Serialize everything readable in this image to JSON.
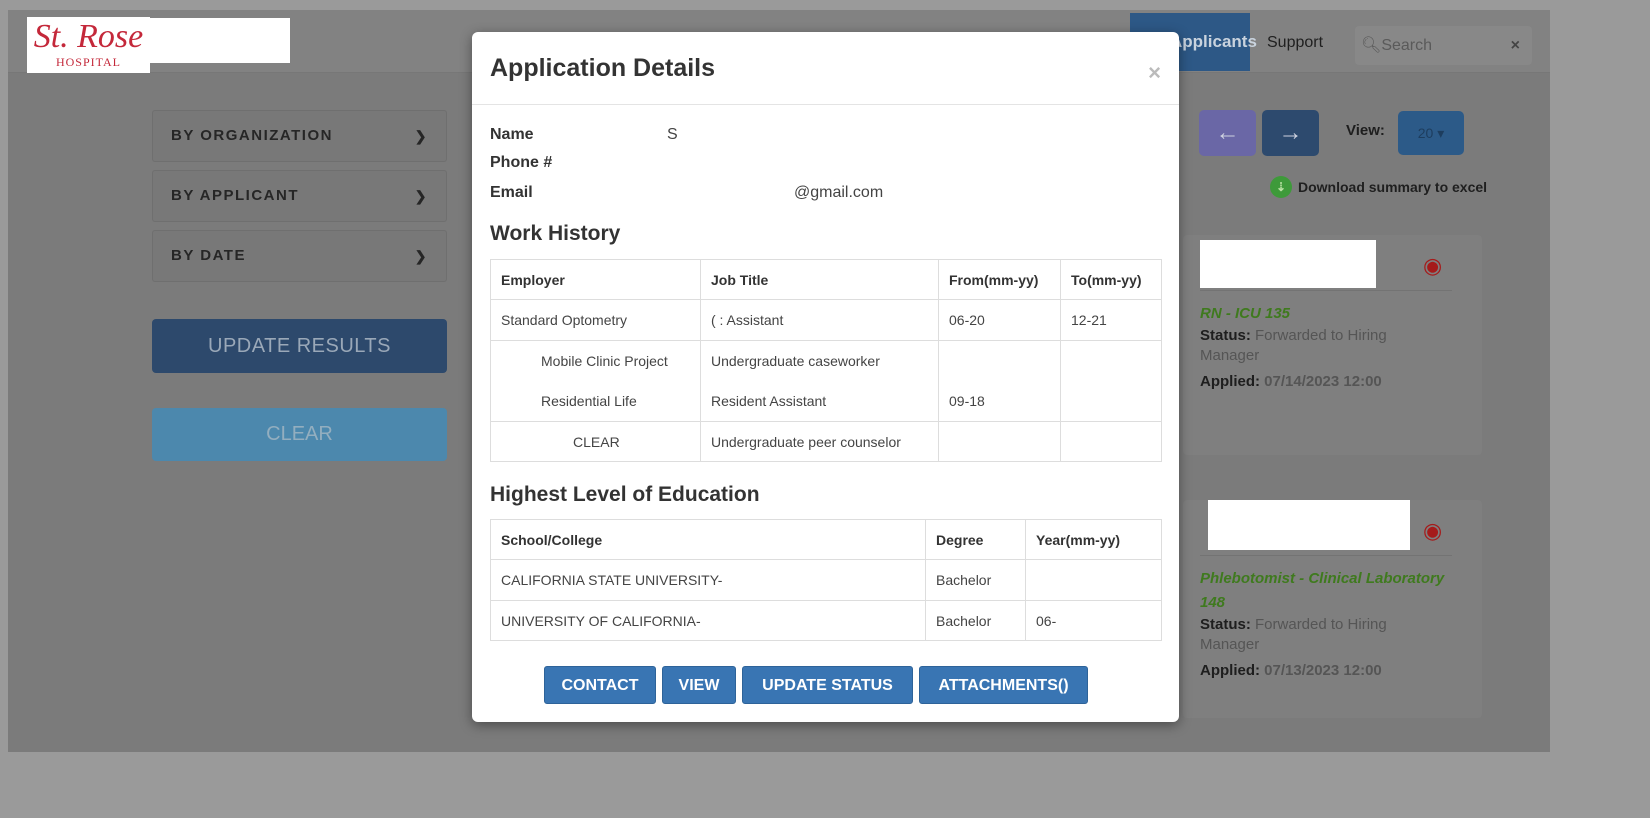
{
  "brand": {
    "logo_main": "St. Rose",
    "logo_sub": "HOSPITAL"
  },
  "nav": {
    "applicants_label": "Applicants",
    "support_label": "Support",
    "search_placeholder": "Search",
    "search_clear": "×"
  },
  "filters": [
    {
      "label": "BY ORGANIZATION"
    },
    {
      "label": "BY APPLICANT"
    },
    {
      "label": "BY DATE"
    }
  ],
  "actions": {
    "update_results": "UPDATE RESULTS",
    "clear": "CLEAR"
  },
  "pager": {
    "prev": "←",
    "next": "→",
    "view_label": "View:",
    "view_value": "20 ▾",
    "download_label": "Download summary to excel"
  },
  "cards": [
    {
      "job": "RN - ICU 135",
      "status_label": "Status:",
      "status": "Forwarded to Hiring Manager",
      "applied_label": "Applied:",
      "applied": "07/14/2023 12:00"
    },
    {
      "job": "Phlebotomist - Clinical Laboratory 148",
      "status_label": "Status:",
      "status": "Forwarded to Hiring Manager",
      "applied_label": "Applied:",
      "applied": "07/13/2023 12:00"
    }
  ],
  "modal": {
    "title": "Application Details",
    "close": "×",
    "name_label": "Name",
    "name_value": "S",
    "phone_label": "Phone #",
    "phone_value": "",
    "email_label": "Email",
    "email_value": "@gmail.com",
    "work_title": "Work History",
    "work_headers": [
      "Employer",
      "Job Title",
      "From(mm-yy)",
      "To(mm-yy)"
    ],
    "work_rows": [
      [
        "Standard Optometry",
        "( : Assistant",
        "06-20",
        "12-21"
      ],
      [
        "Mobile Clinic Project\nResidential Life",
        "Undergraduate caseworker\nResident Assistant",
        "\n09-18",
        ""
      ],
      [
        "CLEAR",
        "Undergraduate peer counselor",
        "",
        ""
      ]
    ],
    "edu_title": "Highest Level of Education",
    "edu_headers": [
      "School/College",
      "Degree",
      "Year(mm-yy)"
    ],
    "edu_rows": [
      [
        "CALIFORNIA STATE UNIVERSITY-",
        "Bachelor",
        ""
      ],
      [
        "UNIVERSITY OF CALIFORNIA-",
        "Bachelor",
        "06-"
      ]
    ],
    "buttons": {
      "contact": "CONTACT",
      "view": "VIEW",
      "update_status": "UPDATE STATUS",
      "attachments": "ATTACHMENTS()"
    }
  }
}
